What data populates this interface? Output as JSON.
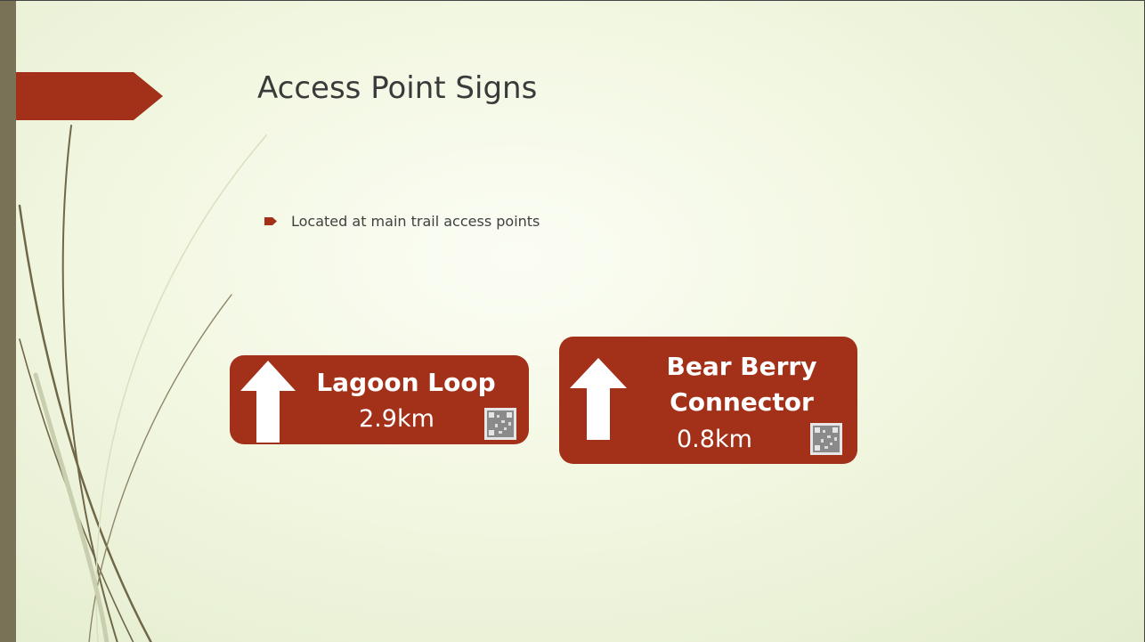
{
  "slide": {
    "title": "Access Point Signs",
    "bullets": [
      "Located at main trail access points"
    ],
    "accent_color": "#a3311a"
  },
  "signs": [
    {
      "name": "Lagoon Loop",
      "distance": "2.9km",
      "icon": "arrow-up-icon"
    },
    {
      "name_line1": "Bear Berry",
      "name_line2": "Connector",
      "distance": "0.8km",
      "icon": "arrow-up-icon"
    }
  ]
}
